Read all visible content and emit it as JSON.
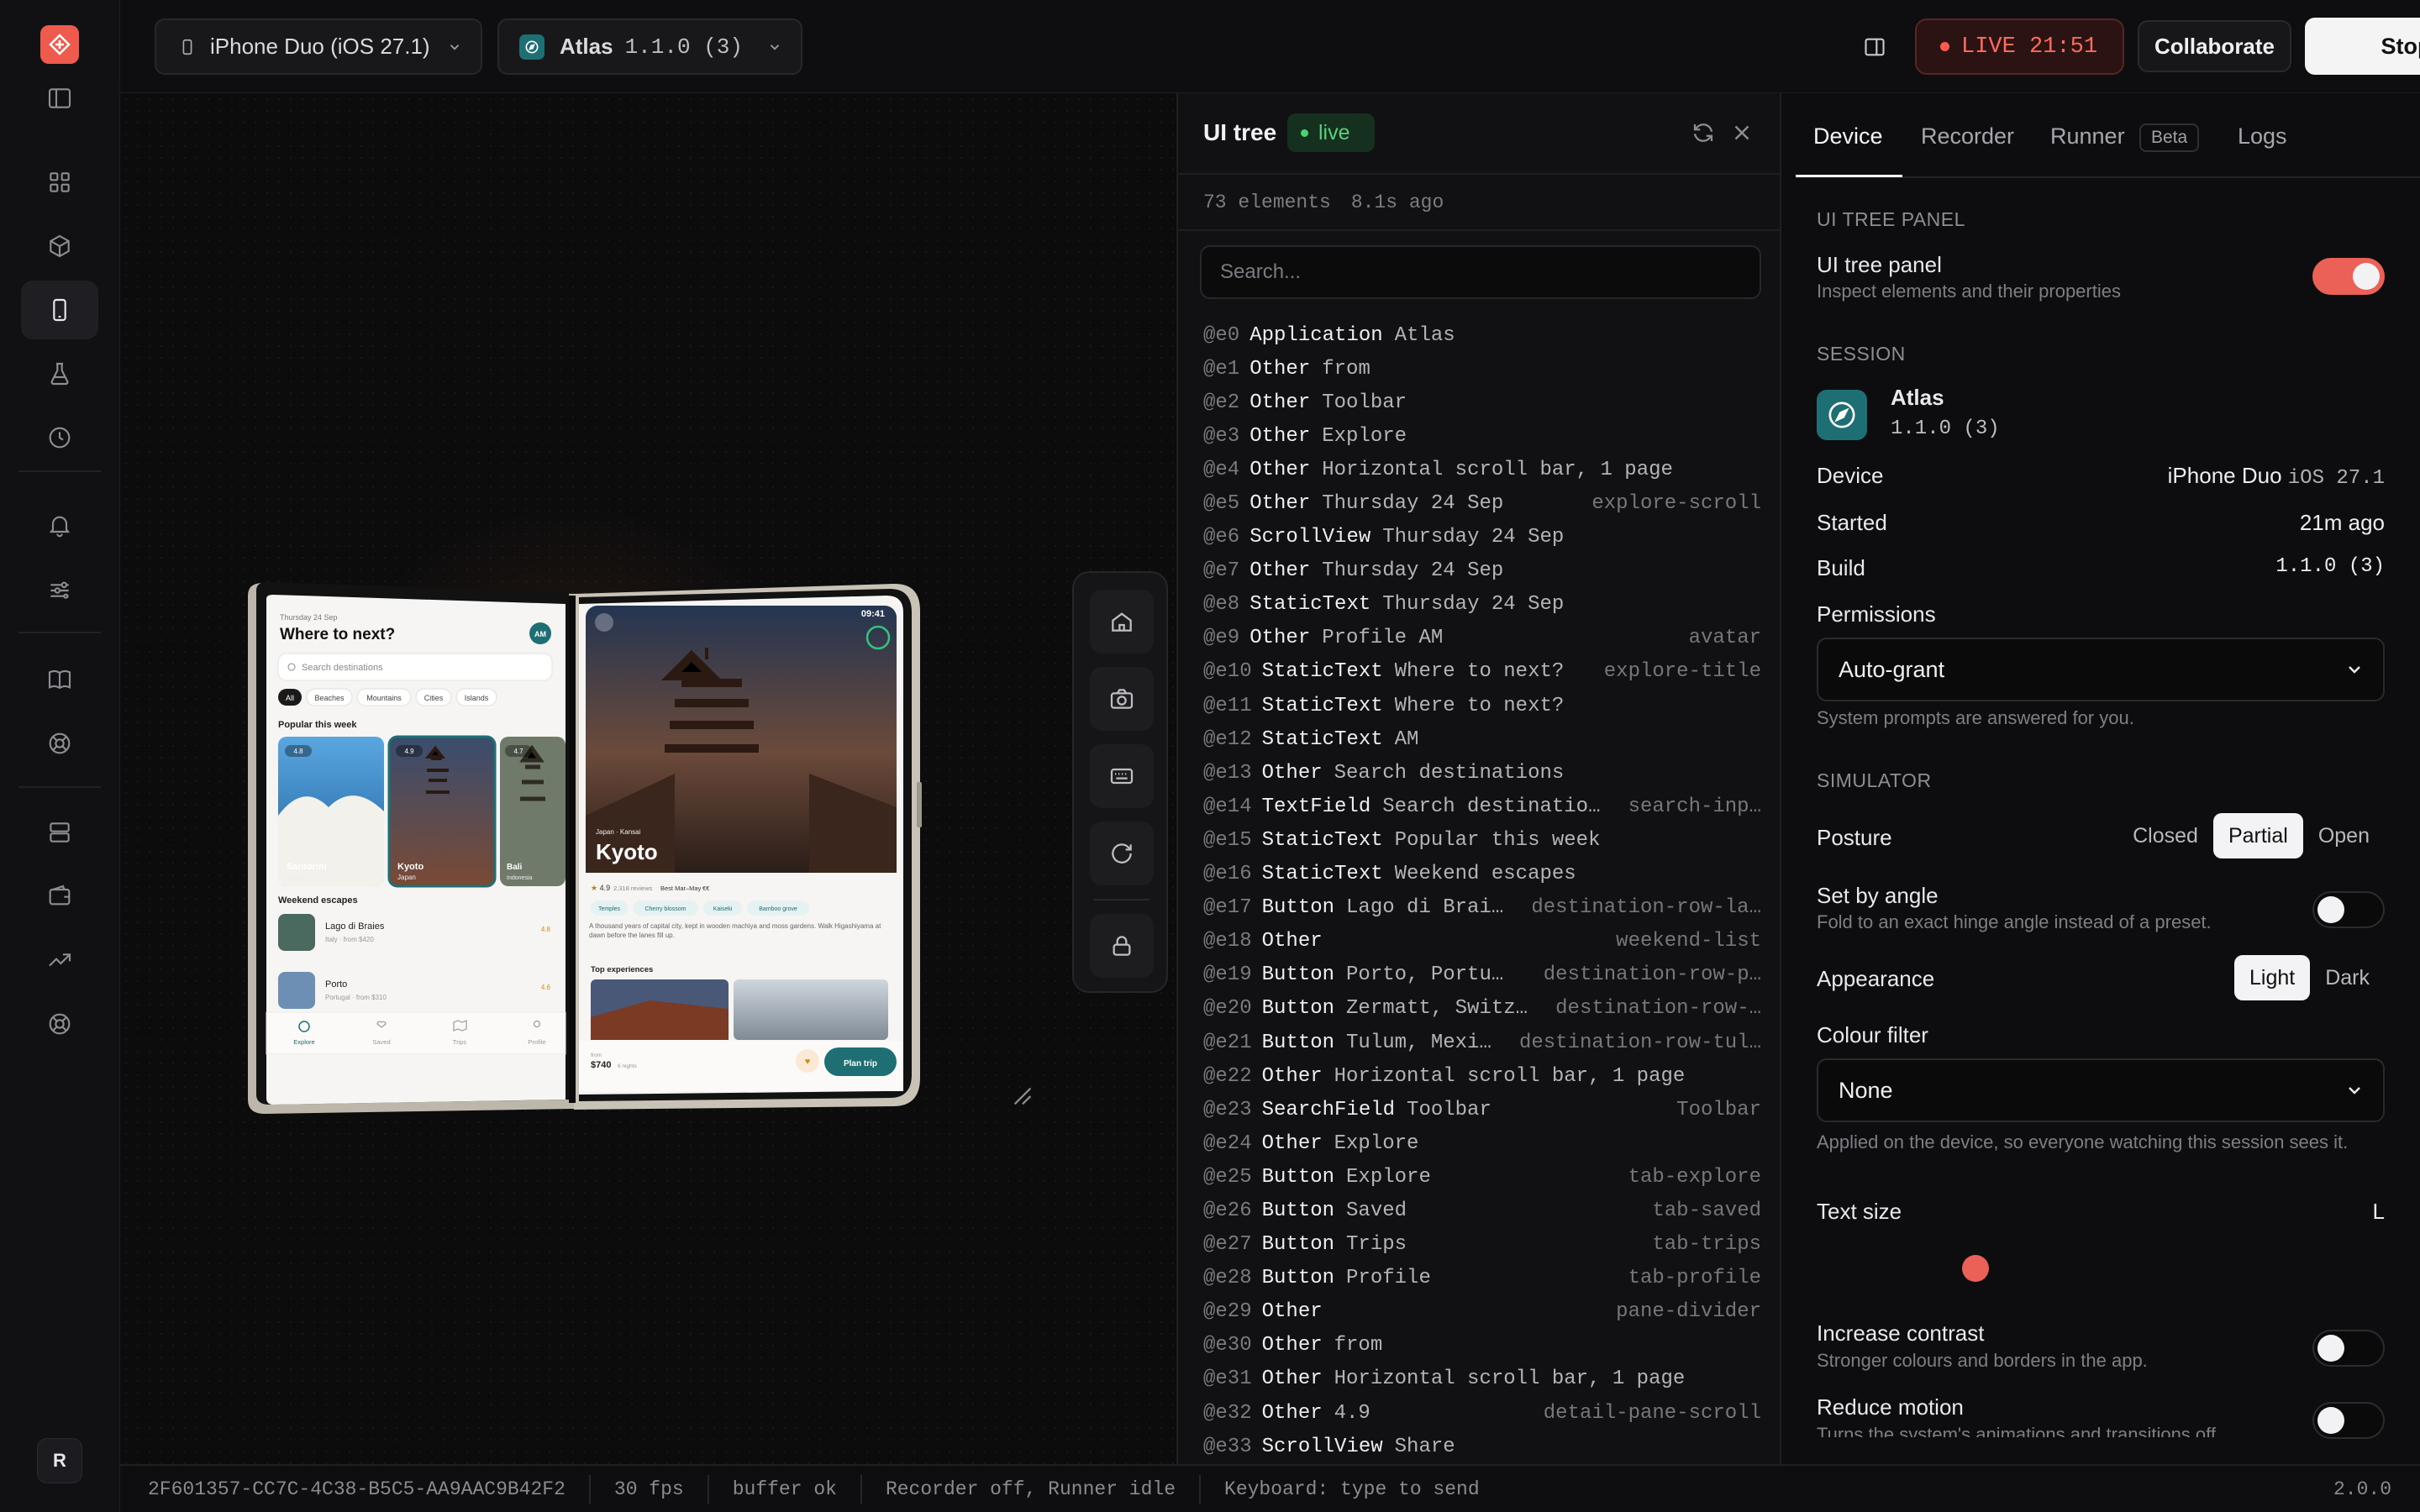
{
  "topbar": {
    "device_picker": "iPhone Duo (iOS 27.1)",
    "app_name": "Atlas",
    "app_version": "1.1.0 (3)",
    "live_label": "LIVE 21:51",
    "collaborate_label": "Collaborate",
    "stop_label": "Stop"
  },
  "rail": {
    "avatar_initial": "R",
    "icons": [
      "layout-grid-icon",
      "cube-icon",
      "phone-icon",
      "flask-icon",
      "history-icon",
      "bell-icon",
      "sliders-icon",
      "book-icon",
      "lifebuoy-icon",
      "server-icon",
      "wallet-icon",
      "trend-icon",
      "support-icon"
    ]
  },
  "device_screen": {
    "left": {
      "date": "Thursday 24 Sep",
      "title": "Where to next?",
      "avatar": "AM",
      "search_placeholder": "Search destinations",
      "chips": [
        "All",
        "Beaches",
        "Mountains",
        "Cities",
        "Islands"
      ],
      "popular_heading": "Popular this week",
      "cards": [
        {
          "name": "Santorini",
          "country": "Greece",
          "rating": "4.8"
        },
        {
          "name": "Kyoto",
          "country": "Japan",
          "rating": "4.9"
        },
        {
          "name": "Bali",
          "country": "Indonesia",
          "rating": "4.7"
        }
      ],
      "weekend_heading": "Weekend escapes",
      "rows": [
        {
          "name": "Lago di Braies",
          "meta": "Italy · from $420",
          "rating": "4.8"
        },
        {
          "name": "Porto",
          "meta": "Portugal · from $310",
          "rating": "4.6"
        }
      ],
      "tabs": [
        "Explore",
        "Saved",
        "Trips",
        "Profile"
      ]
    },
    "right": {
      "time": "09:41",
      "region": "Japan · Kansai",
      "city": "Kyoto",
      "rating_line": "4.9",
      "reviews": "2,318 reviews",
      "best": "Best Mar–May",
      "price_level": "€€",
      "tags": [
        "Temples",
        "Cherry blossom",
        "Kaiseki",
        "Bamboo grove"
      ],
      "description": "A thousand years of capital city, kept in wooden machiya and moss gardens. Walk Higashiyama at dawn before the lanes fill up.",
      "experiences_heading": "Top experiences",
      "from_label": "from",
      "price": "$740",
      "nights": "6 nights",
      "cta": "Plan trip"
    }
  },
  "ui_tree": {
    "title": "UI tree",
    "live": "live",
    "count": "73 elements",
    "age": "8.1s ago",
    "search_placeholder": "Search...",
    "rows": [
      {
        "id": "@e0",
        "type": "Application",
        "label": "Atlas",
        "ref": ""
      },
      {
        "id": "@e1",
        "type": "Other",
        "label": "from",
        "ref": ""
      },
      {
        "id": "@e2",
        "type": "Other",
        "label": "Toolbar",
        "ref": ""
      },
      {
        "id": "@e3",
        "type": "Other",
        "label": "Explore",
        "ref": ""
      },
      {
        "id": "@e4",
        "type": "Other",
        "label": "Horizontal scroll bar, 1 page",
        "ref": ""
      },
      {
        "id": "@e5",
        "type": "Other",
        "label": "Thursday 24 Sep",
        "ref": "explore-scroll"
      },
      {
        "id": "@e6",
        "type": "ScrollView",
        "label": "Thursday 24 Sep",
        "ref": ""
      },
      {
        "id": "@e7",
        "type": "Other",
        "label": "Thursday 24 Sep",
        "ref": ""
      },
      {
        "id": "@e8",
        "type": "StaticText",
        "label": "Thursday 24 Sep",
        "ref": ""
      },
      {
        "id": "@e9",
        "type": "Other",
        "label": "Profile AM",
        "ref": "avatar"
      },
      {
        "id": "@e10",
        "type": "StaticText",
        "label": "Where to next?",
        "ref": "explore-title"
      },
      {
        "id": "@e11",
        "type": "StaticText",
        "label": "Where to next?",
        "ref": ""
      },
      {
        "id": "@e12",
        "type": "StaticText",
        "label": "AM",
        "ref": ""
      },
      {
        "id": "@e13",
        "type": "Other",
        "label": "Search destinations",
        "ref": ""
      },
      {
        "id": "@e14",
        "type": "TextField",
        "label": "Search destinatio…",
        "ref": "search-inp…"
      },
      {
        "id": "@e15",
        "type": "StaticText",
        "label": "Popular this week",
        "ref": ""
      },
      {
        "id": "@e16",
        "type": "StaticText",
        "label": "Weekend escapes",
        "ref": ""
      },
      {
        "id": "@e17",
        "type": "Button",
        "label": "Lago di Brai…",
        "ref": "destination-row-la…"
      },
      {
        "id": "@e18",
        "type": "Other",
        "label": "",
        "ref": "weekend-list"
      },
      {
        "id": "@e19",
        "type": "Button",
        "label": "Porto, Portu…",
        "ref": "destination-row-p…"
      },
      {
        "id": "@e20",
        "type": "Button",
        "label": "Zermatt, Switz…",
        "ref": "destination-row-…"
      },
      {
        "id": "@e21",
        "type": "Button",
        "label": "Tulum, Mexi…",
        "ref": "destination-row-tul…"
      },
      {
        "id": "@e22",
        "type": "Other",
        "label": "Horizontal scroll bar, 1 page",
        "ref": ""
      },
      {
        "id": "@e23",
        "type": "SearchField",
        "label": "Toolbar",
        "ref": "Toolbar"
      },
      {
        "id": "@e24",
        "type": "Other",
        "label": "Explore",
        "ref": ""
      },
      {
        "id": "@e25",
        "type": "Button",
        "label": "Explore",
        "ref": "tab-explore"
      },
      {
        "id": "@e26",
        "type": "Button",
        "label": "Saved",
        "ref": "tab-saved"
      },
      {
        "id": "@e27",
        "type": "Button",
        "label": "Trips",
        "ref": "tab-trips"
      },
      {
        "id": "@e28",
        "type": "Button",
        "label": "Profile",
        "ref": "tab-profile"
      },
      {
        "id": "@e29",
        "type": "Other",
        "label": "",
        "ref": "pane-divider"
      },
      {
        "id": "@e30",
        "type": "Other",
        "label": "from",
        "ref": ""
      },
      {
        "id": "@e31",
        "type": "Other",
        "label": "Horizontal scroll bar, 1 page",
        "ref": ""
      },
      {
        "id": "@e32",
        "type": "Other",
        "label": "4.9",
        "ref": "detail-pane-scroll"
      },
      {
        "id": "@e33",
        "type": "ScrollView",
        "label": "Share",
        "ref": ""
      }
    ]
  },
  "panel": {
    "tabs": {
      "device": "Device",
      "recorder": "Recorder",
      "runner": "Runner",
      "beta": "Beta",
      "logs": "Logs"
    },
    "ui_tree_section": "UI TREE PANEL",
    "ui_tree_label": "UI tree panel",
    "ui_tree_desc": "Inspect elements and their properties",
    "ui_tree_on": true,
    "session_section": "SESSION",
    "app_name": "Atlas",
    "app_version": "1.1.0 (3)",
    "device_label": "Device",
    "device_value": "iPhone Duo",
    "device_os": "iOS 27.1",
    "started_label": "Started",
    "started_value": "21m ago",
    "build_label": "Build",
    "build_value": "1.1.0 (3)",
    "permissions_label": "Permissions",
    "permissions_value": "Auto-grant",
    "permissions_hint": "System prompts are answered for you.",
    "simulator_section": "SIMULATOR",
    "posture_label": "Posture",
    "posture_options": [
      "Closed",
      "Partial",
      "Open"
    ],
    "posture_selected": "Partial",
    "angle_label": "Set by angle",
    "angle_desc": "Fold to an exact hinge angle instead of a preset.",
    "angle_on": false,
    "appearance_label": "Appearance",
    "appearance_options": [
      "Light",
      "Dark"
    ],
    "appearance_selected": "Light",
    "colour_filter_label": "Colour filter",
    "colour_filter_value": "None",
    "colour_filter_hint": "Applied on the device, so everyone watching this session sees it.",
    "text_size_label": "Text size",
    "text_size_value": "L",
    "contrast_label": "Increase contrast",
    "contrast_desc": "Stronger colours and borders in the app.",
    "contrast_on": false,
    "motion_label": "Reduce motion",
    "motion_desc": "Turns the system's animations and transitions off.",
    "motion_on": false
  },
  "statusbar": {
    "session_id": "2F601357-CC7C-4C38-B5C5-AA9AAC9B42F2",
    "fps": "30 fps",
    "buffer": "buffer ok",
    "recorder": "Recorder off, Runner idle",
    "keyboard": "Keyboard: type to send",
    "version": "2.0.0"
  },
  "colors": {
    "accent": "#ec6157",
    "live": "#ff5a4f",
    "teal": "#1d6f73",
    "green": "#4cd273"
  }
}
